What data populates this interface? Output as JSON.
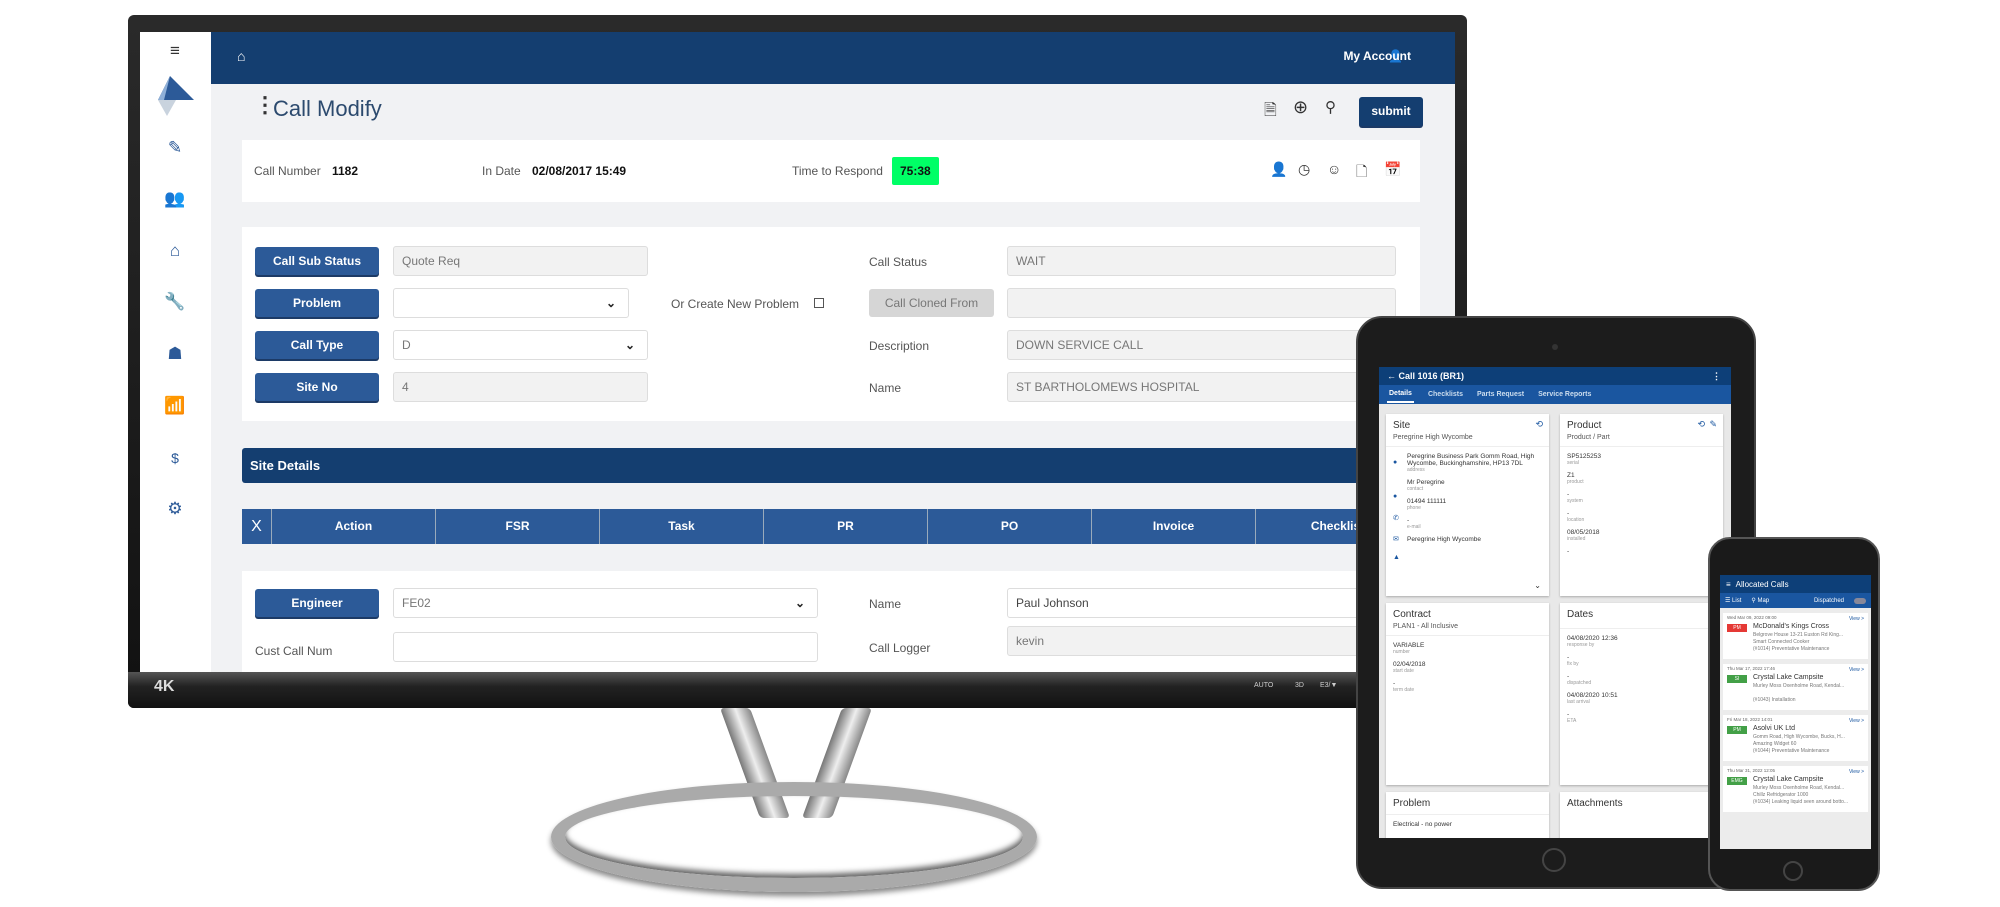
{
  "monitor": {
    "brand_badge": "4K",
    "bezel_labels": [
      "AUTO",
      "3D",
      "E3/▼"
    ],
    "app": {
      "nav": {
        "home_icon": "home-icon",
        "account_label": "My Account"
      },
      "sidebar_icons": [
        "menu-icon",
        "logo",
        "edit-icon",
        "users-icon",
        "building-icon",
        "wrench-icon",
        "handshake-icon",
        "chart-icon",
        "invoice-icon",
        "gear-icon"
      ],
      "title": "Call Modify",
      "submit_label": "submit",
      "info": {
        "call_number_label": "Call Number",
        "call_number": "1182",
        "in_date_label": "In Date",
        "in_date": "02/08/2017 15:49",
        "time_to_respond_label": "Time to Respond",
        "time_to_respond": "75:38",
        "time_color": "#00ff66"
      },
      "form": {
        "call_sub_status_label": "Call Sub Status",
        "call_sub_status": "Quote Req",
        "problem_label": "Problem",
        "problem": "",
        "create_new_problem_label": "Or Create New Problem",
        "call_type_label": "Call Type",
        "call_type": "D",
        "site_no_label": "Site No",
        "site_no": "4",
        "call_status_label": "Call Status",
        "call_status": "WAIT",
        "call_cloned_from_label": "Call Cloned From",
        "call_cloned_from": "",
        "description_label": "Description",
        "description": "DOWN SERVICE CALL",
        "name_label": "Name",
        "name": "ST BARTHOLOMEWS HOSPITAL"
      },
      "site_details_title": "Site Details",
      "table": {
        "close": "X",
        "columns": [
          "Action",
          "FSR",
          "Task",
          "PR",
          "PO",
          "Invoice",
          "Checklist"
        ]
      },
      "engineer": {
        "engineer_label": "Engineer",
        "engineer": "FE02",
        "name_label": "Name",
        "name": "Paul Johnson",
        "cust_call_num_label": "Cust Call Num",
        "cust_call_num": "",
        "call_logger_label": "Call Logger",
        "call_logger": "kevin"
      }
    }
  },
  "tablet": {
    "title": "Call 1016 (BR1)",
    "tabs": [
      "Details",
      "Checklists",
      "Parts Request",
      "Service Reports"
    ],
    "site": {
      "title": "Site",
      "subtitle": "Peregrine High Wycombe",
      "address": "Peregrine Business Park Gomm Road, High Wycombe, Buckinghamshire, HP13 7DL",
      "address_k": "address",
      "contact": "Mr Peregrine",
      "contact_k": "contact",
      "phone": "01494 111111",
      "phone_k": "phone",
      "email": "-",
      "email_k": "e-mail",
      "site": "Peregrine High Wycombe"
    },
    "product": {
      "title": "Product",
      "subtitle": "Product / Part",
      "serial": "SP5125253",
      "serial_k": "serial",
      "product": "Z1",
      "product_k": "product",
      "system": "-",
      "system_k": "system",
      "location": "-",
      "location_k": "location",
      "installed": "08/05/2018",
      "installed_k": "installed",
      "extra": "-"
    },
    "contract": {
      "title": "Contract",
      "subtitle": "PLAN1 - All Inclusive",
      "number": "VARIABLE",
      "number_k": "number",
      "start": "02/04/2018",
      "start_k": "start date",
      "term": "-",
      "term_k": "term date"
    },
    "dates": {
      "title": "Dates",
      "response": "04/08/2020 12:36",
      "response_k": "response by",
      "fix": "-",
      "fix_k": "fix by",
      "dispatched": "-",
      "dispatched_k": "dispatched",
      "arrival": "04/08/2020 10:51",
      "arrival_k": "last arrival",
      "eta": "-",
      "eta_k": "ETA"
    },
    "problem": {
      "title": "Problem",
      "text": "Electrical - no power"
    },
    "attachments": {
      "title": "Attachments"
    }
  },
  "phone": {
    "title": "Allocated Calls",
    "tabs": {
      "list": "List",
      "map": "Map",
      "dispatched": "Dispatched"
    },
    "calls": [
      {
        "date": "Wed Mar 09, 2022 09:00",
        "badge": "PM",
        "color": "#e53935",
        "name": "McDonald's Kings Cross",
        "address": "Belgrove House 13-21 Euston Rd King...",
        "product": "Smart Connected Cooker",
        "job": "(#1014) Preventative Maintenance",
        "view": "View >"
      },
      {
        "date": "Thu Mar 17, 2022 17:46",
        "badge": "SI",
        "color": "#43a047",
        "name": "Crystal Lake Campsite",
        "address": "Murley Moss Oxenholme Road, Kendal...",
        "product": "",
        "job": "(#1043) Installation",
        "view": "View >"
      },
      {
        "date": "Fri Mar 18, 2022 14:01",
        "badge": "PM",
        "color": "#43a047",
        "name": "Asolvi UK Ltd",
        "address": "Gomm Road, High Wycombe, Bucks, H...",
        "product": "Amazing Widget 60",
        "job": "(#1044) Preventative Maintenance",
        "view": "View >"
      },
      {
        "date": "Thu Mar 31, 2022 12:05",
        "badge": "EMG",
        "color": "#43a047",
        "name": "Crystal Lake Campsite",
        "address": "Murley Moss Oxenholme Road, Kendal...",
        "product": "Chillz Refridgerator 1000",
        "job": "(#1034) Leaking liquid seen around botto...",
        "view": "View >"
      }
    ]
  }
}
